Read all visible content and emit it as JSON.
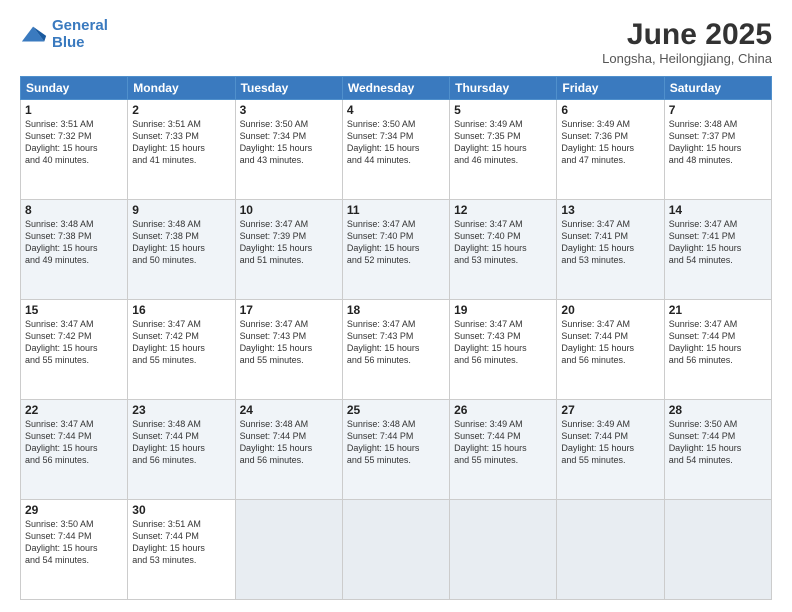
{
  "logo": {
    "line1": "General",
    "line2": "Blue"
  },
  "title": "June 2025",
  "subtitle": "Longsha, Heilongjiang, China",
  "weekdays": [
    "Sunday",
    "Monday",
    "Tuesday",
    "Wednesday",
    "Thursday",
    "Friday",
    "Saturday"
  ],
  "weeks": [
    [
      {
        "day": "1",
        "info": "Sunrise: 3:51 AM\nSunset: 7:32 PM\nDaylight: 15 hours\nand 40 minutes."
      },
      {
        "day": "2",
        "info": "Sunrise: 3:51 AM\nSunset: 7:33 PM\nDaylight: 15 hours\nand 41 minutes."
      },
      {
        "day": "3",
        "info": "Sunrise: 3:50 AM\nSunset: 7:34 PM\nDaylight: 15 hours\nand 43 minutes."
      },
      {
        "day": "4",
        "info": "Sunrise: 3:50 AM\nSunset: 7:34 PM\nDaylight: 15 hours\nand 44 minutes."
      },
      {
        "day": "5",
        "info": "Sunrise: 3:49 AM\nSunset: 7:35 PM\nDaylight: 15 hours\nand 46 minutes."
      },
      {
        "day": "6",
        "info": "Sunrise: 3:49 AM\nSunset: 7:36 PM\nDaylight: 15 hours\nand 47 minutes."
      },
      {
        "day": "7",
        "info": "Sunrise: 3:48 AM\nSunset: 7:37 PM\nDaylight: 15 hours\nand 48 minutes."
      }
    ],
    [
      {
        "day": "8",
        "info": "Sunrise: 3:48 AM\nSunset: 7:38 PM\nDaylight: 15 hours\nand 49 minutes."
      },
      {
        "day": "9",
        "info": "Sunrise: 3:48 AM\nSunset: 7:38 PM\nDaylight: 15 hours\nand 50 minutes."
      },
      {
        "day": "10",
        "info": "Sunrise: 3:47 AM\nSunset: 7:39 PM\nDaylight: 15 hours\nand 51 minutes."
      },
      {
        "day": "11",
        "info": "Sunrise: 3:47 AM\nSunset: 7:40 PM\nDaylight: 15 hours\nand 52 minutes."
      },
      {
        "day": "12",
        "info": "Sunrise: 3:47 AM\nSunset: 7:40 PM\nDaylight: 15 hours\nand 53 minutes."
      },
      {
        "day": "13",
        "info": "Sunrise: 3:47 AM\nSunset: 7:41 PM\nDaylight: 15 hours\nand 53 minutes."
      },
      {
        "day": "14",
        "info": "Sunrise: 3:47 AM\nSunset: 7:41 PM\nDaylight: 15 hours\nand 54 minutes."
      }
    ],
    [
      {
        "day": "15",
        "info": "Sunrise: 3:47 AM\nSunset: 7:42 PM\nDaylight: 15 hours\nand 55 minutes."
      },
      {
        "day": "16",
        "info": "Sunrise: 3:47 AM\nSunset: 7:42 PM\nDaylight: 15 hours\nand 55 minutes."
      },
      {
        "day": "17",
        "info": "Sunrise: 3:47 AM\nSunset: 7:43 PM\nDaylight: 15 hours\nand 55 minutes."
      },
      {
        "day": "18",
        "info": "Sunrise: 3:47 AM\nSunset: 7:43 PM\nDaylight: 15 hours\nand 56 minutes."
      },
      {
        "day": "19",
        "info": "Sunrise: 3:47 AM\nSunset: 7:43 PM\nDaylight: 15 hours\nand 56 minutes."
      },
      {
        "day": "20",
        "info": "Sunrise: 3:47 AM\nSunset: 7:44 PM\nDaylight: 15 hours\nand 56 minutes."
      },
      {
        "day": "21",
        "info": "Sunrise: 3:47 AM\nSunset: 7:44 PM\nDaylight: 15 hours\nand 56 minutes."
      }
    ],
    [
      {
        "day": "22",
        "info": "Sunrise: 3:47 AM\nSunset: 7:44 PM\nDaylight: 15 hours\nand 56 minutes."
      },
      {
        "day": "23",
        "info": "Sunrise: 3:48 AM\nSunset: 7:44 PM\nDaylight: 15 hours\nand 56 minutes."
      },
      {
        "day": "24",
        "info": "Sunrise: 3:48 AM\nSunset: 7:44 PM\nDaylight: 15 hours\nand 56 minutes."
      },
      {
        "day": "25",
        "info": "Sunrise: 3:48 AM\nSunset: 7:44 PM\nDaylight: 15 hours\nand 55 minutes."
      },
      {
        "day": "26",
        "info": "Sunrise: 3:49 AM\nSunset: 7:44 PM\nDaylight: 15 hours\nand 55 minutes."
      },
      {
        "day": "27",
        "info": "Sunrise: 3:49 AM\nSunset: 7:44 PM\nDaylight: 15 hours\nand 55 minutes."
      },
      {
        "day": "28",
        "info": "Sunrise: 3:50 AM\nSunset: 7:44 PM\nDaylight: 15 hours\nand 54 minutes."
      }
    ],
    [
      {
        "day": "29",
        "info": "Sunrise: 3:50 AM\nSunset: 7:44 PM\nDaylight: 15 hours\nand 54 minutes."
      },
      {
        "day": "30",
        "info": "Sunrise: 3:51 AM\nSunset: 7:44 PM\nDaylight: 15 hours\nand 53 minutes."
      },
      null,
      null,
      null,
      null,
      null
    ]
  ]
}
